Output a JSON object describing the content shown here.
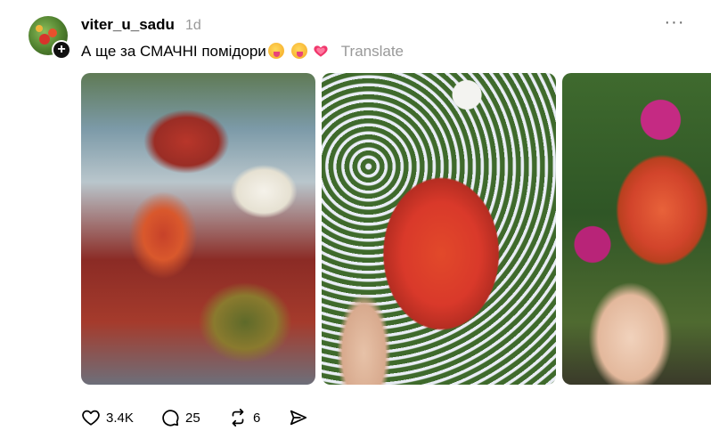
{
  "post": {
    "author": {
      "username": "viter_u_sadu"
    },
    "timestamp": "1d",
    "caption": {
      "text": "А ще за СМАЧНІ помідори",
      "emojis": [
        "😝",
        "😝",
        "💗"
      ]
    },
    "translate_label": "Translate",
    "more_icon": "ellipsis-icon",
    "follow_icon": "plus-icon",
    "images": [
      {
        "name": "photo-sliced-tomatoes-plate"
      },
      {
        "name": "photo-tomato-in-hand-flowers"
      },
      {
        "name": "photo-tomato-in-hand-petunias"
      }
    ],
    "actions": {
      "like": {
        "icon": "heart-icon",
        "count": "3.4K"
      },
      "comment": {
        "icon": "comment-icon",
        "count": "25"
      },
      "repost": {
        "icon": "repost-icon",
        "count": "6"
      },
      "share": {
        "icon": "share-icon"
      }
    }
  },
  "colors": {
    "text": "#000000",
    "muted": "#999999",
    "background": "#ffffff",
    "heart_emoji": "#f0376c"
  }
}
